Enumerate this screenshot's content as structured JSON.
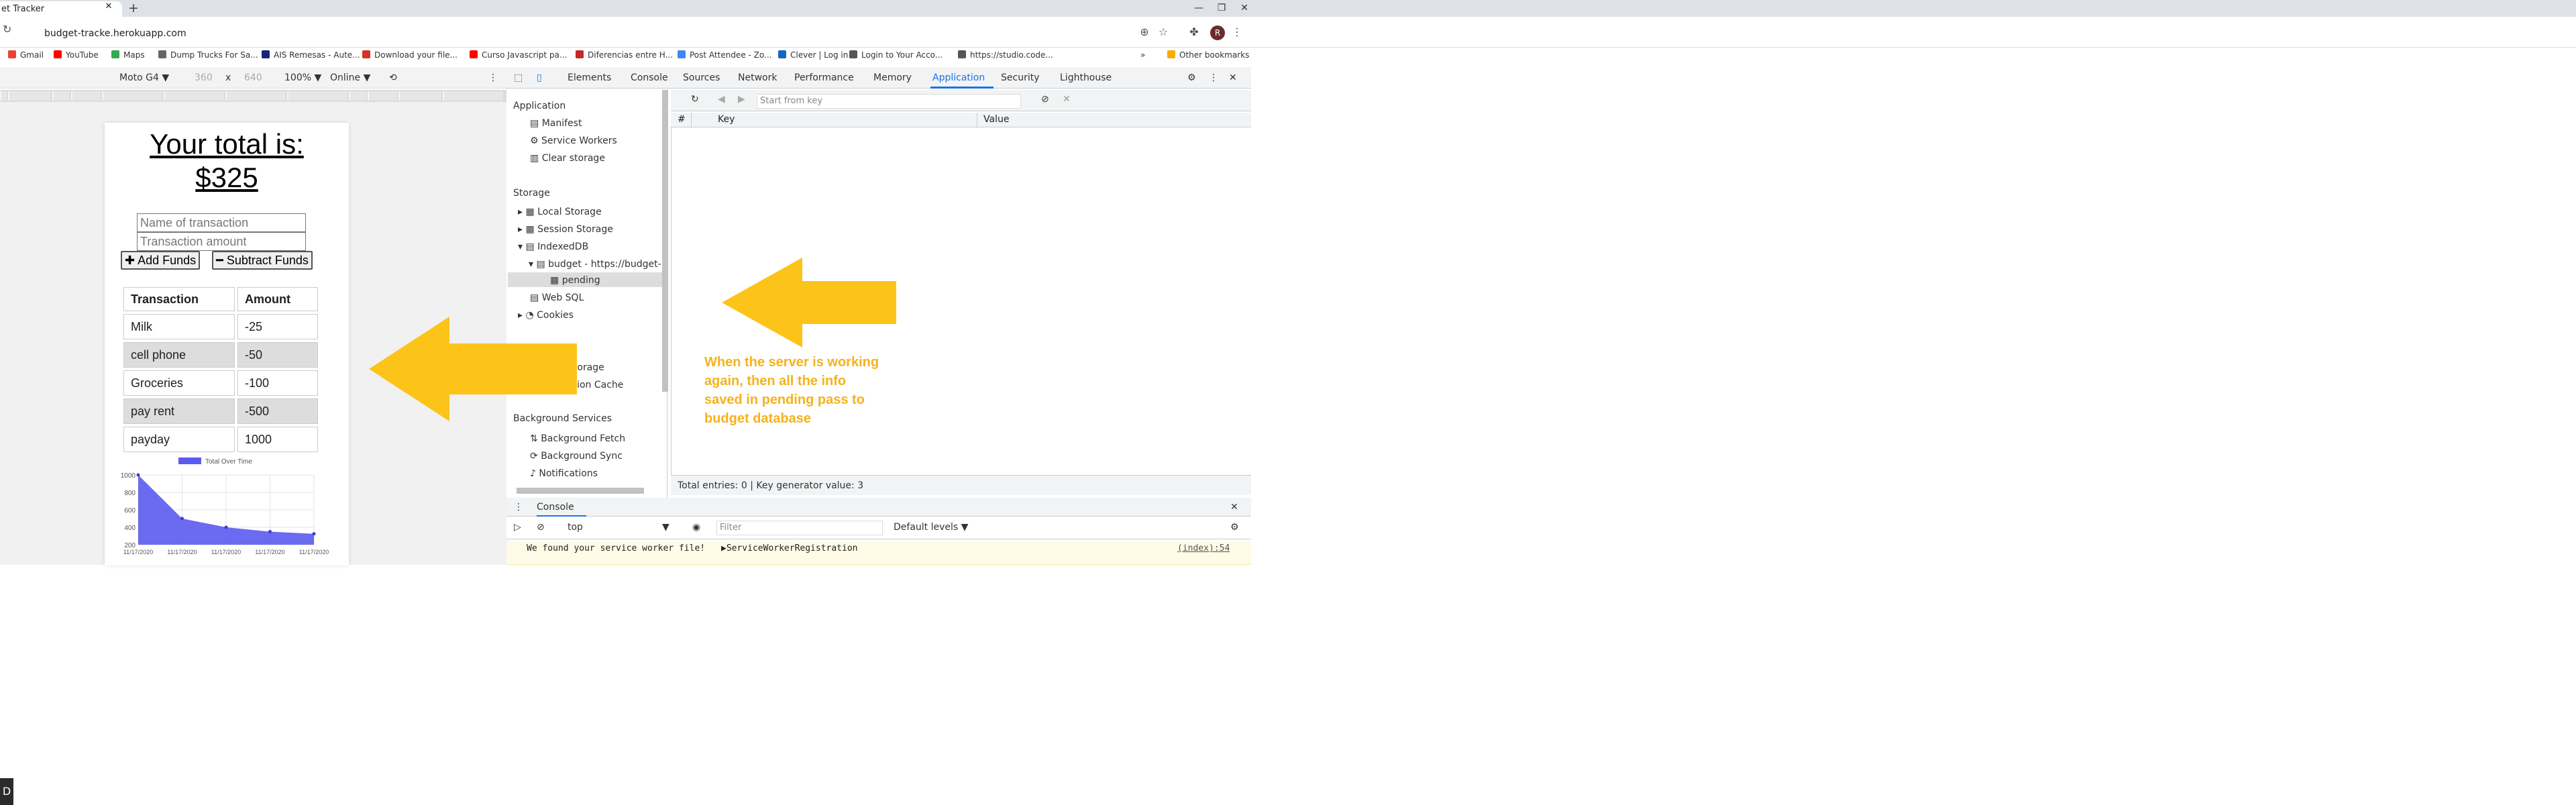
{
  "browser": {
    "tab_title": "et Tracker",
    "tab_close": "✕",
    "newtab": "+",
    "url": "budget-tracke.herokuapp.com",
    "avatar": "R",
    "window_controls": [
      "—",
      "❐",
      "✕"
    ],
    "bookmarks": [
      {
        "label": "Gmail",
        "color": "#ea4335"
      },
      {
        "label": "YouTube",
        "color": "#ff0000"
      },
      {
        "label": "Maps",
        "color": "#34a853"
      },
      {
        "label": "Dump Trucks For Sa...",
        "color": "#666666"
      },
      {
        "label": "AIS Remesas - Aute...",
        "color": "#1a237e"
      },
      {
        "label": "Download your file...",
        "color": "#d93025"
      },
      {
        "label": "Curso Javascript pa...",
        "color": "#ff0000"
      },
      {
        "label": "Diferencias entre H...",
        "color": "#c62828"
      },
      {
        "label": "Post Attendee - Zo...",
        "color": "#4285f4"
      },
      {
        "label": "Clever | Log in",
        "color": "#1565c0"
      },
      {
        "label": "Login to Your Acco...",
        "color": "#555555"
      },
      {
        "label": "https://studio.code...",
        "color": "#555555"
      }
    ],
    "more_bookmarks": "»",
    "other_bookmarks": "Other bookmarks"
  },
  "device_toolbar": {
    "device": "Moto G4 ▼",
    "width": "360",
    "times": "x",
    "height": "640",
    "zoom": "100% ▼",
    "network": "Online ▼"
  },
  "app": {
    "total_line1": "Your total is:",
    "total_line2": "$325",
    "name_placeholder": "Name of transaction",
    "amount_placeholder": "Transaction amount",
    "add_button": "✚ Add Funds",
    "subtract_button": "━ Subtract Funds",
    "table_headers": [
      "Transaction",
      "Amount"
    ],
    "rows": [
      {
        "name": "Milk",
        "amount": "-25"
      },
      {
        "name": "cell phone",
        "amount": "-50"
      },
      {
        "name": "Groceries",
        "amount": "-100"
      },
      {
        "name": "pay rent",
        "amount": "-500"
      },
      {
        "name": "payday",
        "amount": "1000"
      }
    ]
  },
  "chart_data": {
    "type": "area",
    "title": "",
    "series": [
      {
        "name": "Total Over Time",
        "values": [
          1000,
          500,
          400,
          350,
          325
        ],
        "color": "#5b5bf0"
      }
    ],
    "x": [
      "11/17/2020",
      "11/17/2020",
      "11/17/2020",
      "11/17/2020",
      "11/17/2020"
    ],
    "yticks": [
      1000,
      800,
      600,
      400,
      200
    ],
    "ylim": [
      200,
      1000
    ],
    "grid": true,
    "legend": "top"
  },
  "devtools": {
    "tabs": [
      "Elements",
      "Console",
      "Sources",
      "Network",
      "Performance",
      "Memory",
      "Application",
      "Security",
      "Lighthouse"
    ],
    "active_tab": "Application",
    "sidebar": {
      "application_header": "Application",
      "manifest": "Manifest",
      "service_workers": "Service Workers",
      "clear_storage": "Clear storage",
      "storage_header": "Storage",
      "local_storage": "Local Storage",
      "session_storage": "Session Storage",
      "indexeddb": "IndexedDB",
      "budget_db": "budget - https://budget-",
      "pending": "pending",
      "web_sql": "Web SQL",
      "cookies": "Cookies",
      "cache_storage_partial": "Storage",
      "app_cache_partial": "ation Cache",
      "bg_header": "Background Services",
      "bg_fetch": "Background Fetch",
      "bg_sync": "Background Sync",
      "notifications": "Notifications"
    },
    "key_filter_placeholder": "Start from key",
    "columns": [
      "#",
      "Key",
      "Value"
    ],
    "footer": "Total entries: 0  |  Key generator value: 3",
    "console_tab": "Console",
    "context": "top",
    "filter_placeholder": "Filter",
    "levels": "Default levels ▼",
    "log_message": "We found your service worker file!",
    "log_object": "▶ServiceWorkerRegistration",
    "log_source": "(index):54"
  },
  "annotation": {
    "note": "When the server is working again, then all the info saved in pending pass to budget database",
    "arrow_color": "#fcc419"
  },
  "corner_glyph": "D"
}
